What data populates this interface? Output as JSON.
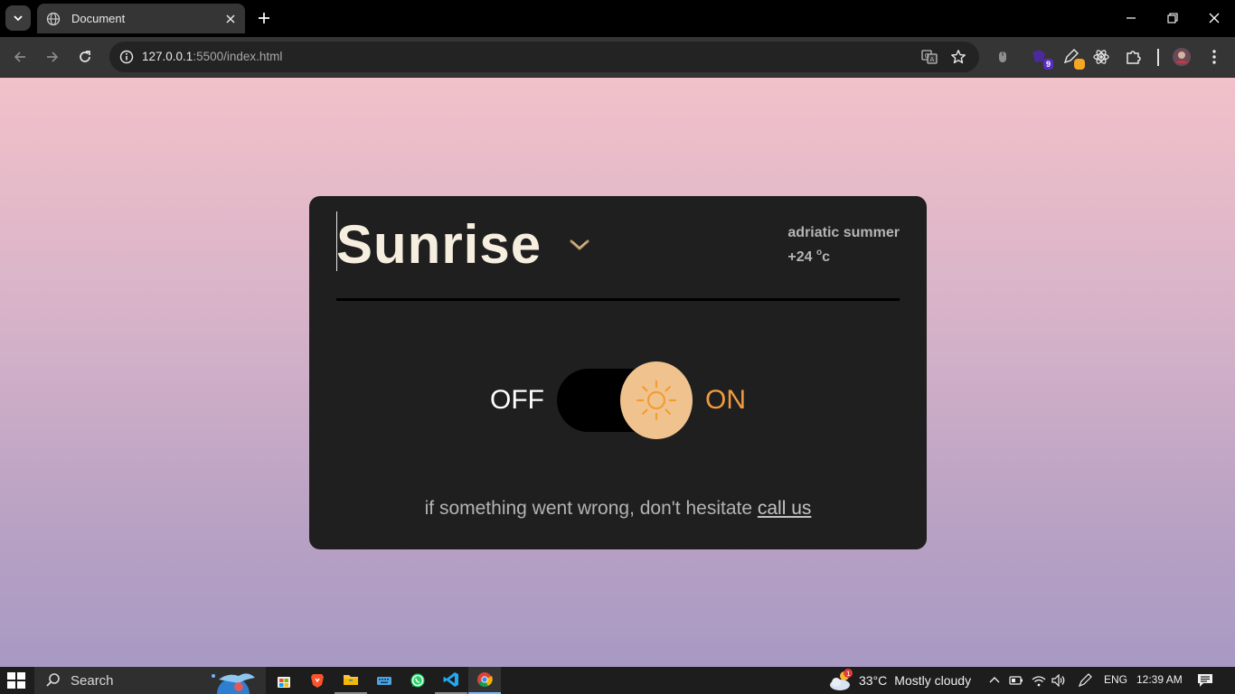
{
  "browser": {
    "tab": {
      "title": "Document"
    },
    "address": {
      "host": "127.0.0.1",
      "rest": ":5500/index.html"
    },
    "extensions": {
      "badge_count": "9"
    }
  },
  "page": {
    "title": "Sunrise",
    "weather": {
      "place": "adriatic summer",
      "temp_value": "+24 ",
      "temp_deg": "o",
      "temp_unit": "c"
    },
    "toggle": {
      "off_label": "OFF",
      "on_label": "ON",
      "state": "on"
    },
    "help": {
      "text": "if something went wrong, don't hesitate ",
      "link": "call us"
    }
  },
  "colors": {
    "card_bg": "#1f1f1f",
    "title": "#f6eedf",
    "accent_on": "#f19a3e",
    "knob": "#f0c38e"
  },
  "taskbar": {
    "search_placeholder": "Search",
    "weather": {
      "temp": "33°C",
      "condition": "Mostly cloudy",
      "alert_count": "1"
    },
    "language": "ENG",
    "time": "12:39 AM"
  }
}
